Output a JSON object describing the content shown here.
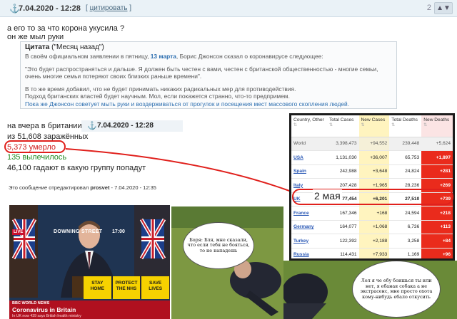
{
  "post_header": {
    "date": "7.04.2020 - 12:28",
    "quote_label": "цитировать",
    "counter": "2"
  },
  "post": {
    "line1": "а его то за что корона укусила ?",
    "line2": "он же мыл руки",
    "citation": {
      "label": "Цитата",
      "source": "(\"Месяц назад\")",
      "p1_pre": "В своём официальном заявлении в пятницу,",
      "p1_date": "13 марта",
      "p1_post": ", Борис Джонсон сказал о коронавирусе следующее:",
      "p2": "\"Это будет распространяться и дальше. Я должен быть честен с вами, честен с британской общественностью - многие семьи, очень многие семьи потеряют своих близких раньше времени\".",
      "p3a": "В то же время добавил, что не будет принимать никаких радикальных мер для противодействия.",
      "p3b": "Подход британских властей будет научным. Мол, если покажется странно, что-то предпримем.",
      "p3c": "Пока же Джонсон советует мыть руки и воздерживаться от прогулок и посещения мест массового скопления людей."
    }
  },
  "reply": {
    "line1": "на вчера в британии",
    "date": "7.04.2020 - 12:28",
    "line2": "из 51,608 заражённых",
    "died": "5,373 умерло",
    "recovered": "135 вылечилось",
    "line5": "46,100 гадают в какую группу попадут",
    "edited_pre": "Это сообщение отредактировал",
    "edited_user": "prosvet",
    "edited_post": "- 7.04.2020 - 12:35"
  },
  "annotation": {
    "may_label": "2 мая"
  },
  "table": {
    "headers": [
      "Country, Other",
      "Total Cases",
      "New Cases",
      "Total Deaths",
      "New Deaths"
    ],
    "world": {
      "country": "World",
      "total_cases": "3,398,473",
      "new_cases": "+94,552",
      "total_deaths": "239,448",
      "new_deaths": "+5,624"
    },
    "rows": [
      {
        "country": "USA",
        "total_cases": "1,131,030",
        "new_cases": "+36,007",
        "total_deaths": "65,753",
        "new_deaths": "+1,897"
      },
      {
        "country": "Spain",
        "total_cases": "242,988",
        "new_cases": "+3,648",
        "total_deaths": "24,824",
        "new_deaths": "+281"
      },
      {
        "country": "Italy",
        "total_cases": "207,428",
        "new_cases": "+1,965",
        "total_deaths": "28,236",
        "new_deaths": "+269"
      },
      {
        "country": "UK",
        "total_cases": "177,454",
        "new_cases": "+6,201",
        "total_deaths": "27,510",
        "new_deaths": "+739"
      },
      {
        "country": "France",
        "total_cases": "167,346",
        "new_cases": "+168",
        "total_deaths": "24,594",
        "new_deaths": "+218"
      },
      {
        "country": "Germany",
        "total_cases": "164,077",
        "new_cases": "+1,068",
        "total_deaths": "6,736",
        "new_deaths": "+113"
      },
      {
        "country": "Turkey",
        "total_cases": "122,392",
        "new_cases": "+2,188",
        "total_deaths": "3,258",
        "new_deaths": "+84"
      },
      {
        "country": "Russia",
        "total_cases": "114,431",
        "new_cases": "+7,933",
        "total_deaths": "1,169",
        "new_deaths": "+96"
      }
    ]
  },
  "image1": {
    "location": "DOWNING STREET",
    "time": "17:00",
    "live": "LIVE",
    "slogan": [
      "STAY",
      "HOME",
      "PROTECT",
      "THE NHS",
      "SAVE",
      "LIVES"
    ],
    "channel": "BBC WORLD NEWS",
    "headline": "Coronavirus in Britain",
    "ticker": "In UK now 439 says British health ministry"
  },
  "image2": {
    "bubble1": "Боря: Бля, мне сказали, что если тебя не бояться, то не нападешь",
    "bubble2": "Лол я че ебу боишься ты или нет, я ебаная собака а не экстрасенс, мне просто охота кому-нибудь ебало откусить"
  },
  "colors": {
    "link": "#2a58b5",
    "died": "#d02020",
    "recovered": "#228b22",
    "highlight_red": "#e0201c",
    "new_deaths_bg": "#ea2b1c",
    "new_cases_bg": "#fff4bf"
  }
}
